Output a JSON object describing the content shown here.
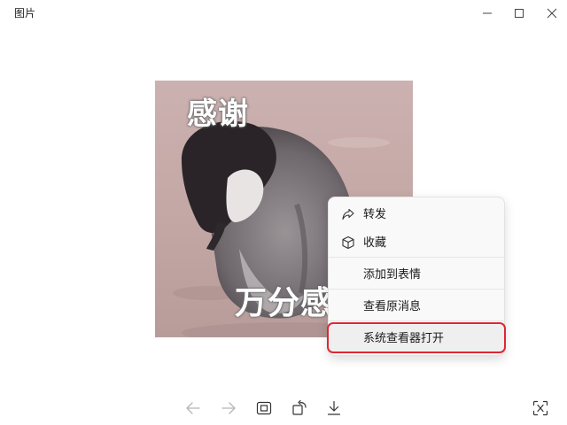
{
  "window": {
    "title": "图片"
  },
  "image": {
    "caption_top": "感谢",
    "caption_bottom": "万分感谢"
  },
  "context_menu": {
    "items": [
      {
        "label": "转发",
        "icon": "share-arrow-icon"
      },
      {
        "label": "收藏",
        "icon": "cube-icon"
      },
      {
        "label": "添加到表情",
        "icon": ""
      },
      {
        "label": "查看原消息",
        "icon": ""
      },
      {
        "label": "系统查看器打开",
        "icon": "",
        "highlighted": true
      }
    ]
  },
  "toolbar": {
    "icons": [
      "arrow-left-icon",
      "arrow-right-icon",
      "fit-screen-icon",
      "rotate-icon",
      "download-icon",
      "text-recognize-icon"
    ]
  },
  "colors": {
    "highlight_border": "#e02633",
    "menu_bg": "#f9f9f9"
  }
}
